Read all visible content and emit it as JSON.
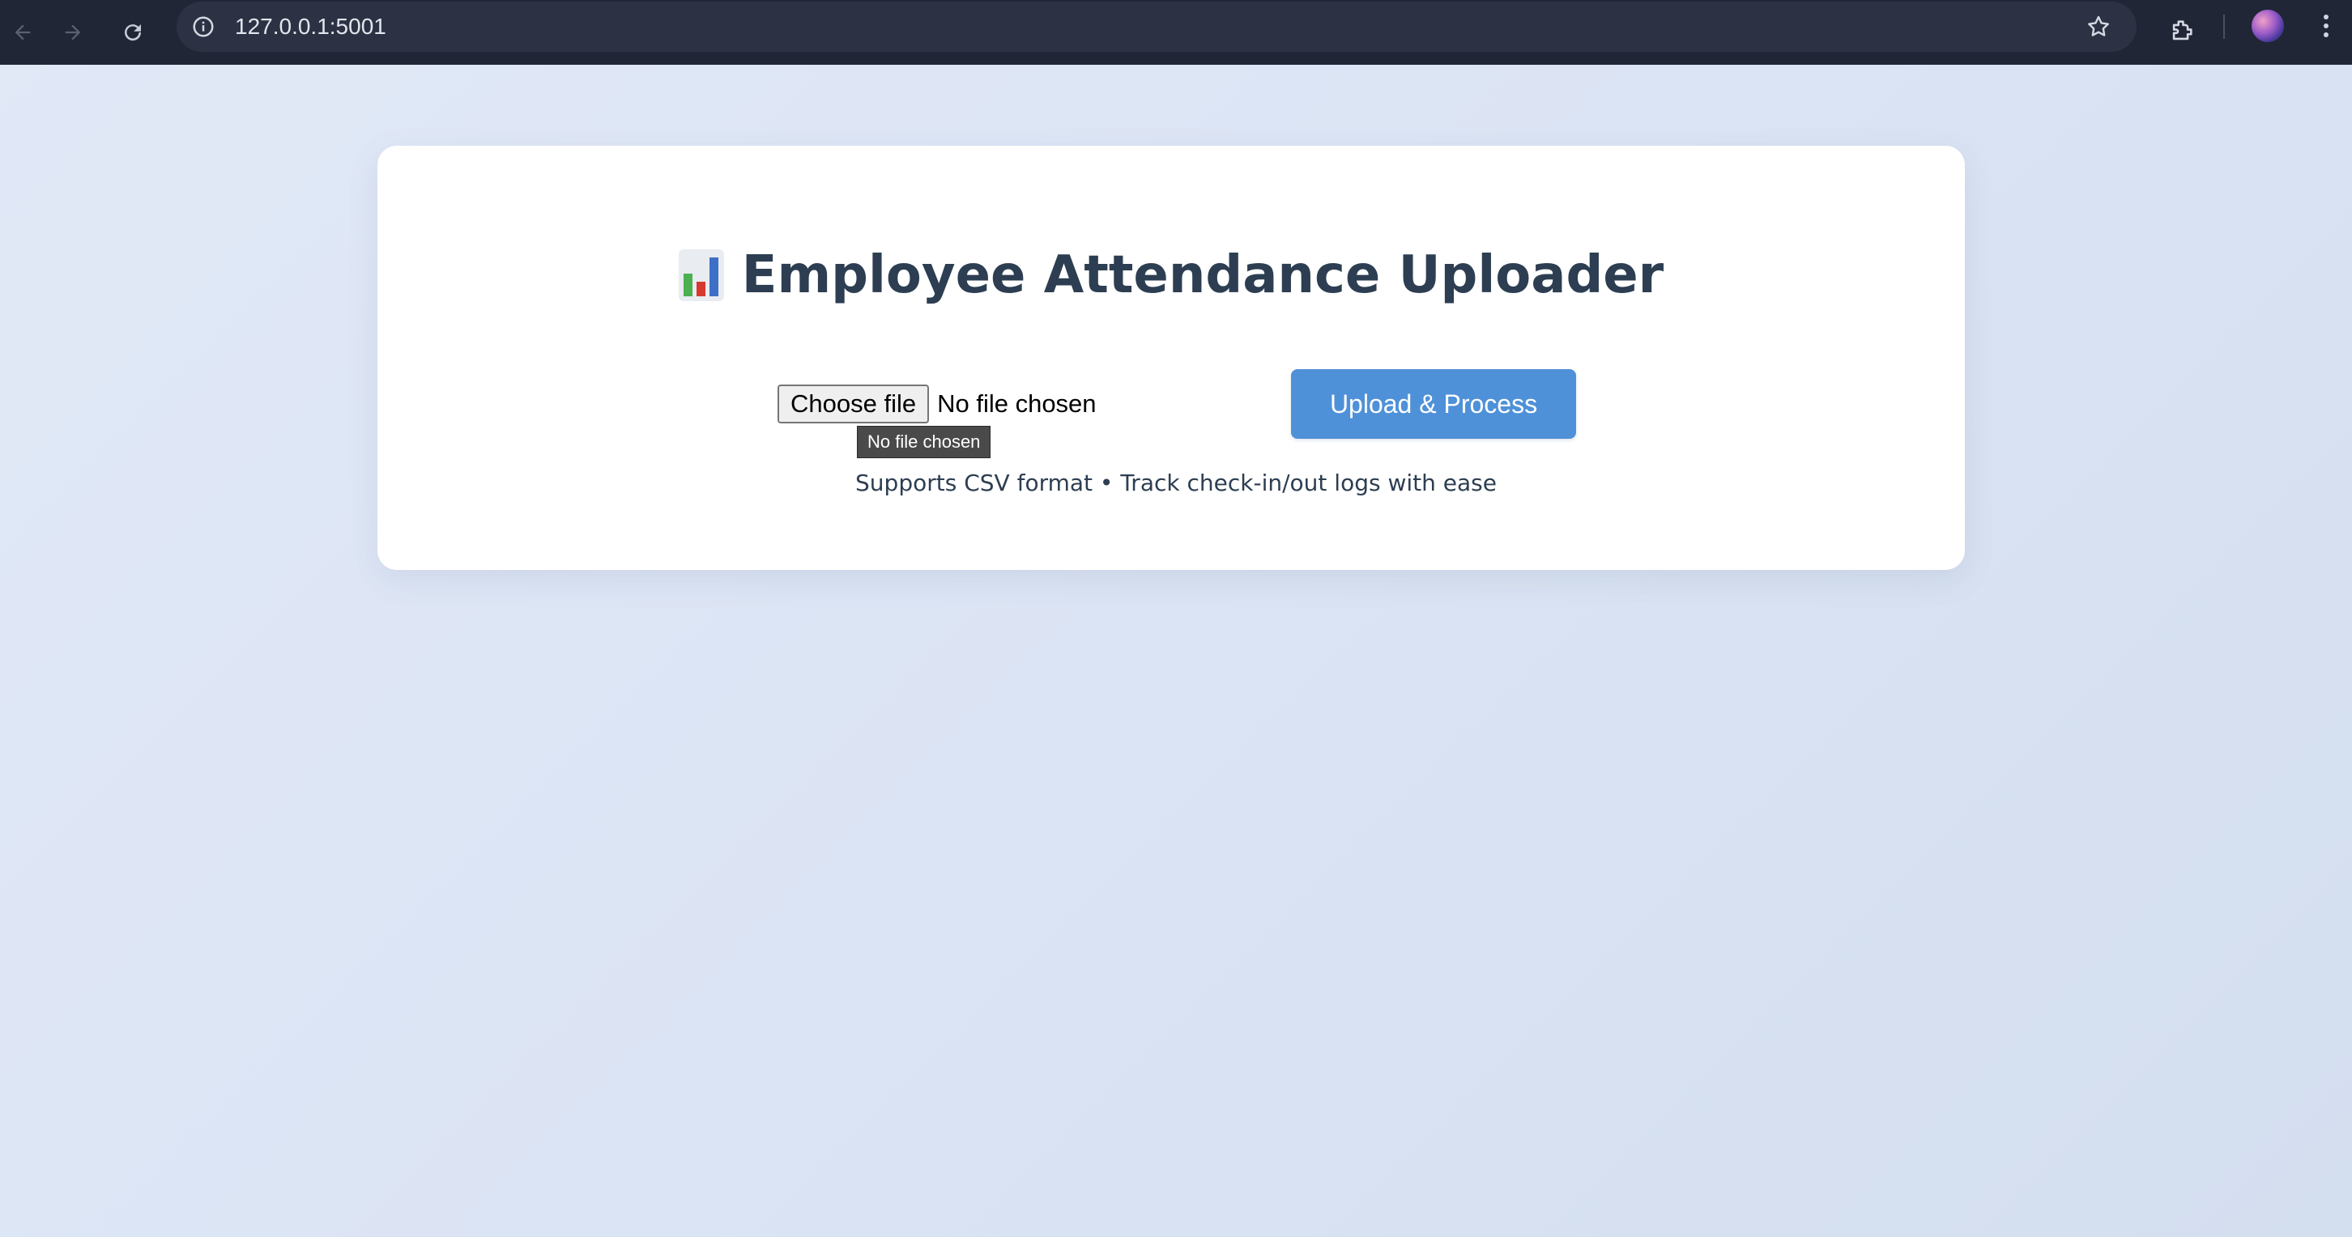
{
  "browser": {
    "url": "127.0.0.1:5001"
  },
  "page": {
    "title": "Employee Attendance Uploader",
    "title_icon": "bar-chart-icon",
    "file_input": {
      "button_label": "Choose file",
      "status_text": "No file chosen",
      "tooltip": "No file chosen"
    },
    "upload_button_label": "Upload & Process",
    "subtitle": "Supports CSV format • Track check-in/out logs with ease"
  },
  "colors": {
    "accent": "#4f91d8",
    "title_text": "#2d3e52",
    "chrome_bg": "#202636",
    "page_bg": "#dbe4f4"
  }
}
